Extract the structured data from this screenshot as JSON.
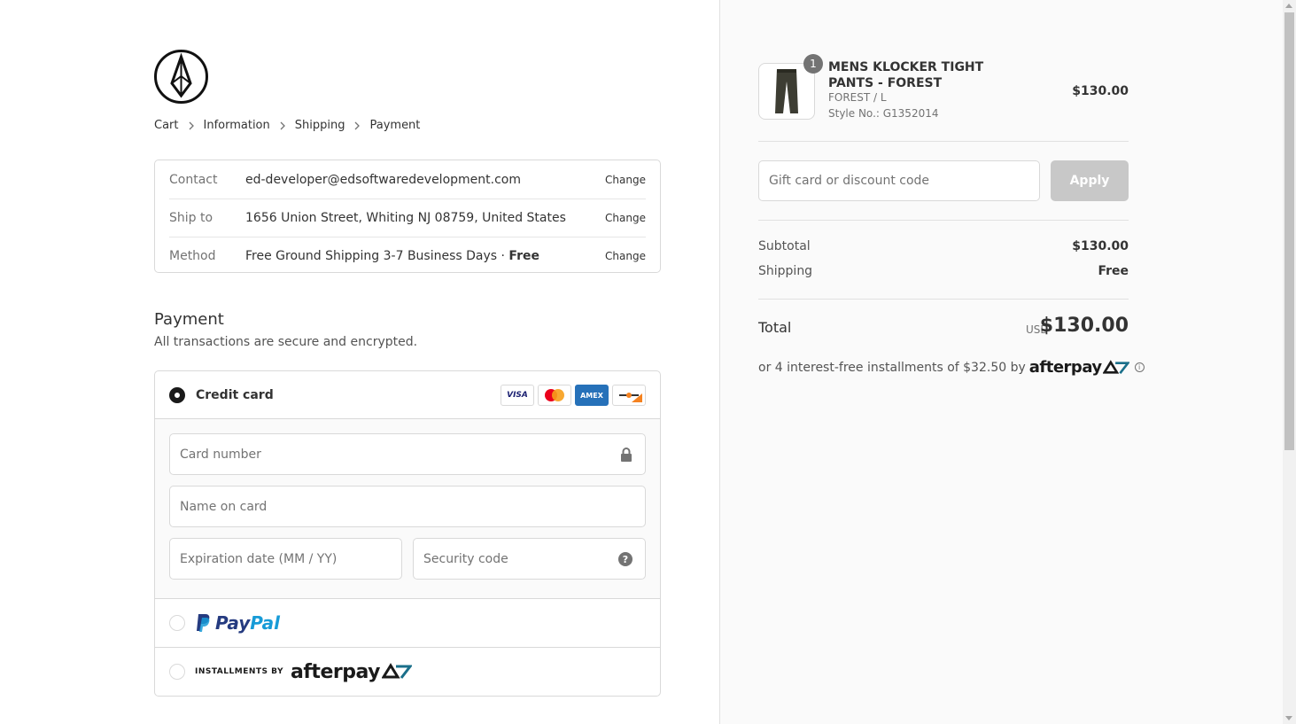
{
  "breadcrumb": [
    "Cart",
    "Information",
    "Shipping",
    "Payment"
  ],
  "review": {
    "contact_label": "Contact",
    "contact_value": "ed-developer@edsoftwaredevelopment.com",
    "shipto_label": "Ship to",
    "shipto_value": "1656 Union Street, Whiting NJ 08759, United States",
    "method_label": "Method",
    "method_value": "Free Ground Shipping 3-7 Business Days · ",
    "method_price": "Free",
    "change_label": "Change"
  },
  "payment": {
    "title": "Payment",
    "subtitle": "All transactions are secure and encrypted.",
    "credit_card_label": "Credit card",
    "card_brands": [
      "VISA",
      "",
      "AMEX",
      ""
    ],
    "card_number_placeholder": "Card number",
    "name_placeholder": "Name on card",
    "expiry_placeholder": "Expiration date (MM / YY)",
    "security_placeholder": "Security code",
    "paypal_pay": "Pay",
    "paypal_pal": "Pal",
    "installments_label": "INSTALLMENTS BY",
    "afterpay_label": "afterpay"
  },
  "order": {
    "quantity": "1",
    "product_name": "MENS KLOCKER TIGHT PANTS - FOREST",
    "variant": "FOREST / L",
    "style_no": "Style No.: G1352014",
    "price": "$130.00",
    "discount_placeholder": "Gift card or discount code",
    "apply_label": "Apply",
    "subtotal_label": "Subtotal",
    "subtotal_value": "$130.00",
    "shipping_label": "Shipping",
    "shipping_value": "Free",
    "total_label": "Total",
    "currency": "USD",
    "total_value": "$130.00",
    "afterpay_note": "or 4 interest-free installments of $32.50 by",
    "afterpay_logo": "afterpay"
  },
  "colors": {
    "accent": "#1a1a1a",
    "sidebar_bg": "#fafafa",
    "border": "#d9d9d9",
    "paypal_dark": "#253b80",
    "paypal_light": "#179bd7",
    "amex": "#2671b9"
  }
}
